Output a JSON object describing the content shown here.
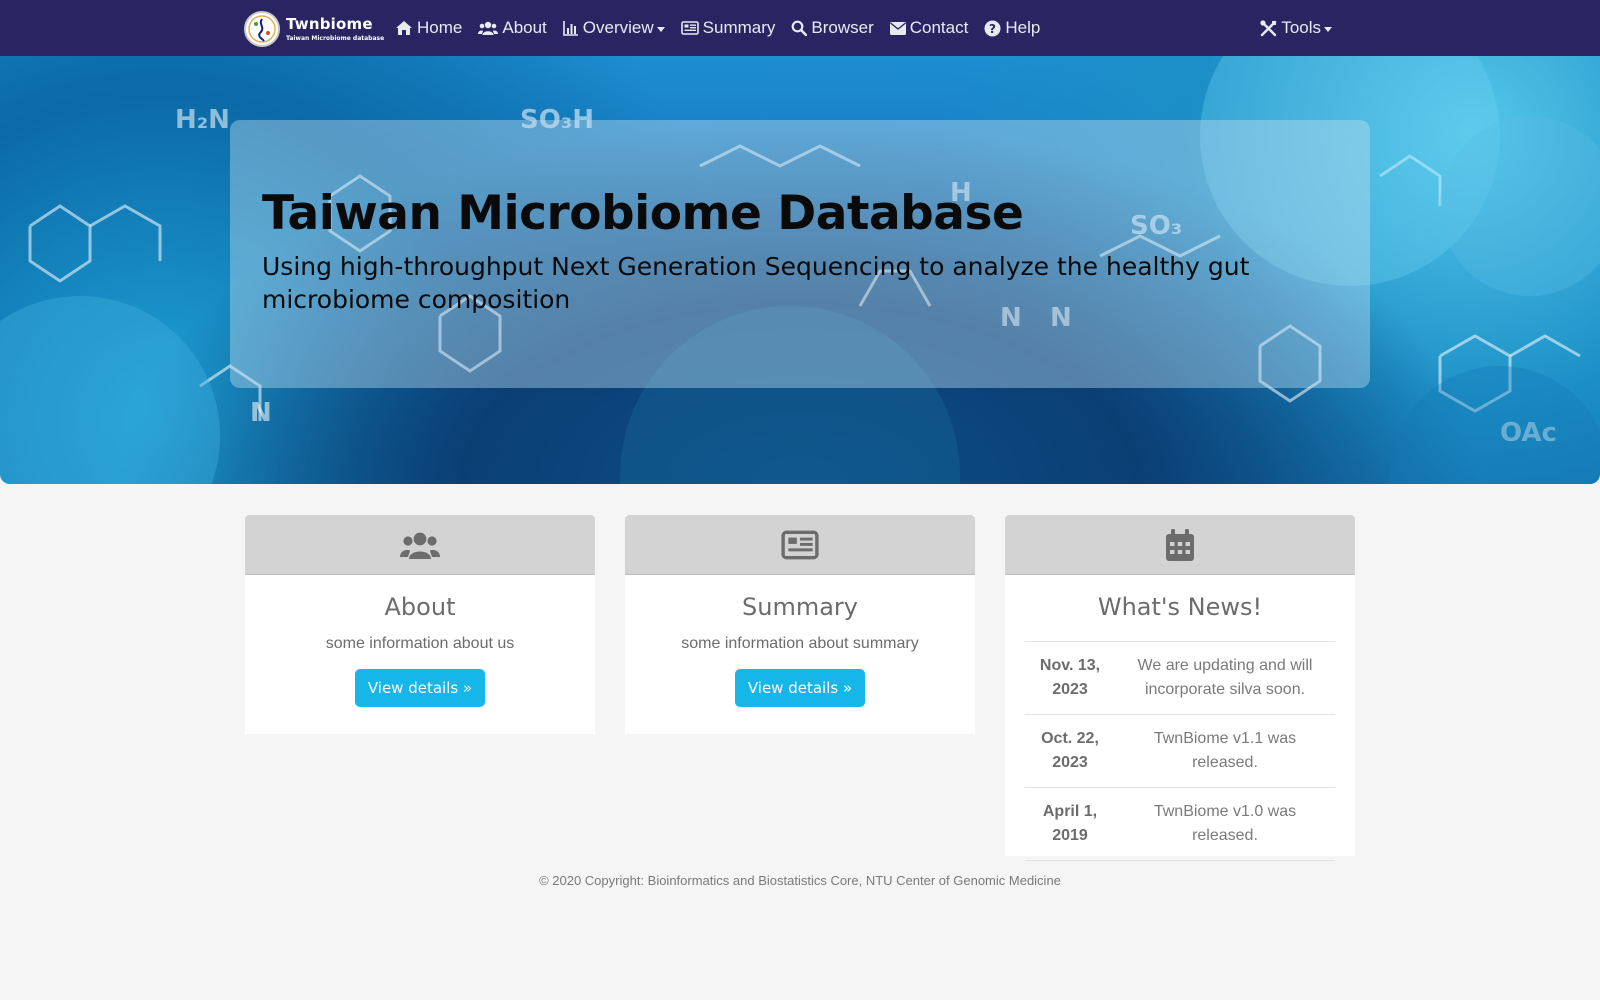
{
  "brand": {
    "name": "Twnbiome",
    "subtitle": "Taiwan Microbiome database"
  },
  "nav": {
    "home": "Home",
    "about": "About",
    "overview": "Overview",
    "summary": "Summary",
    "browser": "Browser",
    "contact": "Contact",
    "help": "Help",
    "tools": "Tools"
  },
  "hero": {
    "title": "Taiwan Microbiome Database",
    "subtitle": "Using high-throughput Next Generation Sequencing to analyze the healthy gut microbiome composition"
  },
  "cards": {
    "about": {
      "icon": "users-icon",
      "title": "About",
      "text": "some information about us",
      "button": "View details »"
    },
    "summary": {
      "icon": "newspaper-icon",
      "title": "Summary",
      "text": "some information about summary",
      "button": "View details »"
    },
    "news": {
      "icon": "calendar-icon",
      "title": "What's News!",
      "items": [
        {
          "date": "Nov. 13, 2023",
          "text": "We are updating and will incorporate silva soon."
        },
        {
          "date": "Oct. 22, 2023",
          "text": "TwnBiome v1.1 was released."
        },
        {
          "date": "April 1, 2019",
          "text": "TwnBiome v1.0 was released."
        }
      ]
    }
  },
  "footer": {
    "text": "© 2020 Copyright: Bioinformatics and Biostatistics Core, NTU Center of Genomic Medicine"
  },
  "colors": {
    "navbar": "#2a2562",
    "button": "#17b6e9",
    "card_header": "#d3d3d3",
    "background": "#f5f5f5"
  }
}
